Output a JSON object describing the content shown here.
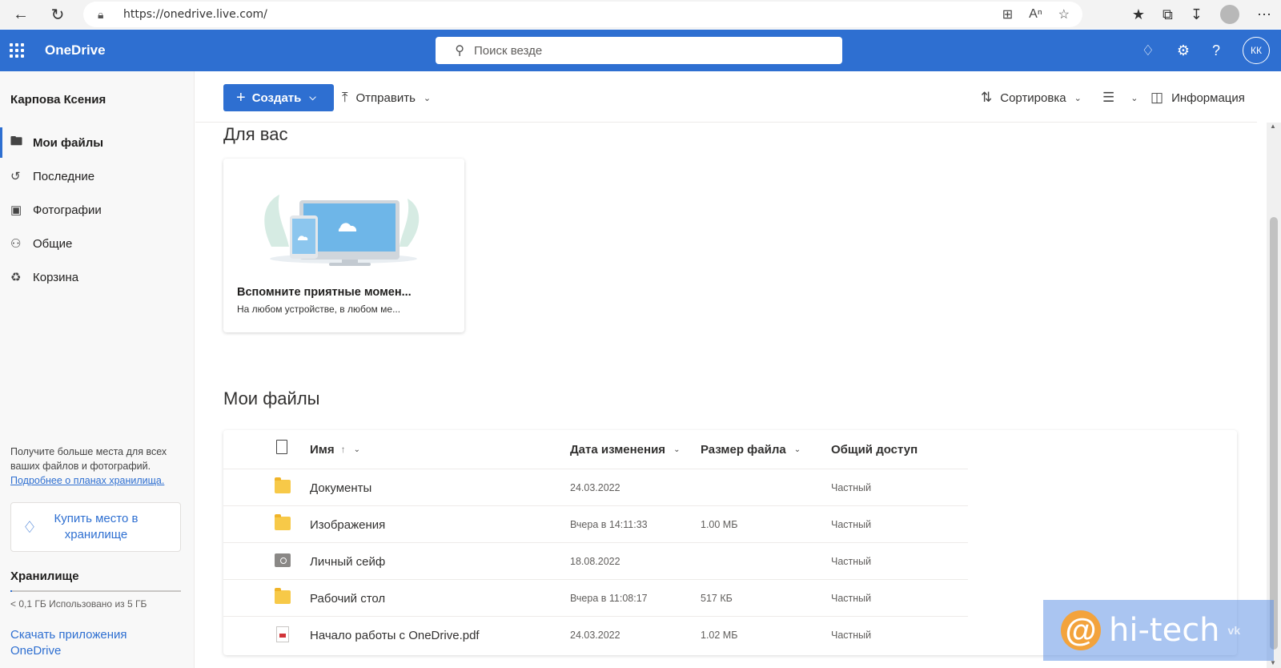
{
  "browser": {
    "url": "https://onedrive.live.com/"
  },
  "header": {
    "brand": "OneDrive",
    "search_placeholder": "Поиск везде",
    "avatar_initials": "КК"
  },
  "sidebar": {
    "user_name": "Карпова Ксения",
    "items": [
      {
        "label": "Мои файлы",
        "icon": "folder-icon",
        "active": true
      },
      {
        "label": "Последние",
        "icon": "history-icon"
      },
      {
        "label": "Фотографии",
        "icon": "photo-icon"
      },
      {
        "label": "Общие",
        "icon": "people-icon"
      },
      {
        "label": "Корзина",
        "icon": "recycle-bin-icon"
      }
    ],
    "promo_text": "Получите больше места для всех ваших файлов и фотографий.",
    "promo_link": "Подробнее о планах хранилища.",
    "buy_storage_label": "Купить место в хранилище",
    "storage_title": "Хранилище",
    "storage_used_text": "< 0,1 ГБ Использовано из 5 ГБ",
    "storage_used_fraction": 0.01,
    "download_apps": "Скачать приложения OneDrive"
  },
  "commandbar": {
    "create_label": "Создать",
    "upload_label": "Отправить",
    "sort_label": "Сортировка",
    "info_label": "Информация"
  },
  "for_you": {
    "title": "Для вас",
    "card_title": "Вспомните приятные момен...",
    "card_subtitle": "На любом устройстве, в любом ме..."
  },
  "my_files": {
    "title": "Мои файлы",
    "columns": {
      "name": "Имя",
      "modified": "Дата изменения",
      "size": "Размер файла",
      "sharing": "Общий доступ"
    },
    "rows": [
      {
        "name": "Документы",
        "modified": "24.03.2022",
        "size": "",
        "sharing": "Частный",
        "type": "folder"
      },
      {
        "name": "Изображения",
        "modified": "Вчера в 14:11:33",
        "size": "1.00 МБ",
        "sharing": "Частный",
        "type": "folder"
      },
      {
        "name": "Личный сейф",
        "modified": "18.08.2022",
        "size": "",
        "sharing": "Частный",
        "type": "vault"
      },
      {
        "name": "Рабочий стол",
        "modified": "Вчера в 11:08:17",
        "size": "517 КБ",
        "sharing": "Частный",
        "type": "folder"
      },
      {
        "name": "Начало работы с OneDrive.pdf",
        "modified": "24.03.2022",
        "size": "1.02 МБ",
        "sharing": "Частный",
        "type": "pdf"
      }
    ]
  },
  "watermark": {
    "text": "hi-tech",
    "at": "@",
    "vk": "vk"
  },
  "colors": {
    "accent": "#2e6fd1",
    "folder": "#f7c948"
  }
}
